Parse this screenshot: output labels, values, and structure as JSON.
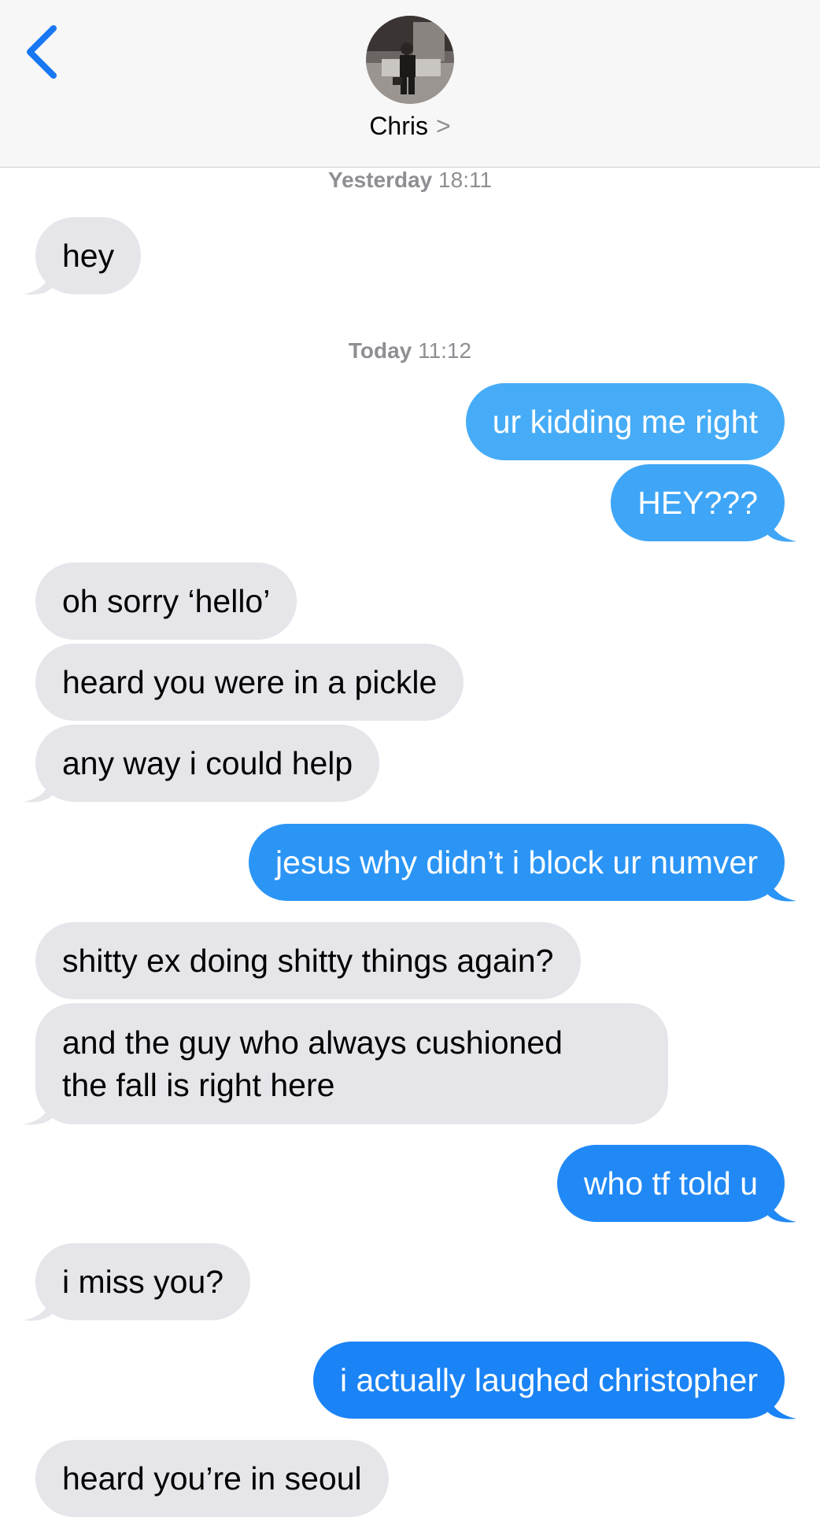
{
  "header": {
    "contact_name": "Chris",
    "contact_chevron": ">",
    "back_icon": "chevron-left-icon"
  },
  "timestamps": [
    {
      "day": "Yesterday",
      "time": "18:11"
    },
    {
      "day": "Today",
      "time": "11:12"
    }
  ],
  "messages": [
    {
      "side": "in",
      "text": "hey"
    },
    {
      "side": "out",
      "text": "ur kidding me right"
    },
    {
      "side": "out",
      "text": "HEY???"
    },
    {
      "side": "in",
      "text": "oh sorry ‘hello’"
    },
    {
      "side": "in",
      "text": "heard you were in a pickle"
    },
    {
      "side": "in",
      "text": "any way i could help"
    },
    {
      "side": "out",
      "text": "jesus why didn’t i block ur numver"
    },
    {
      "side": "in",
      "text": "shitty ex doing shitty things again?"
    },
    {
      "side": "in",
      "text_line1": "and the guy who always cushioned",
      "text_line2": "the fall is right here"
    },
    {
      "side": "out",
      "text": "who tf told u"
    },
    {
      "side": "in",
      "text": "i miss you?"
    },
    {
      "side": "out",
      "text": "i actually laughed christopher"
    },
    {
      "side": "in",
      "text": "heard you’re in seoul"
    }
  ],
  "colors": {
    "incoming_bubble": "#e5e5ea",
    "outgoing_bubble_light": "#47acf7",
    "outgoing_bubble_dark": "#1a83f5",
    "ios_blue": "#1877f2"
  }
}
